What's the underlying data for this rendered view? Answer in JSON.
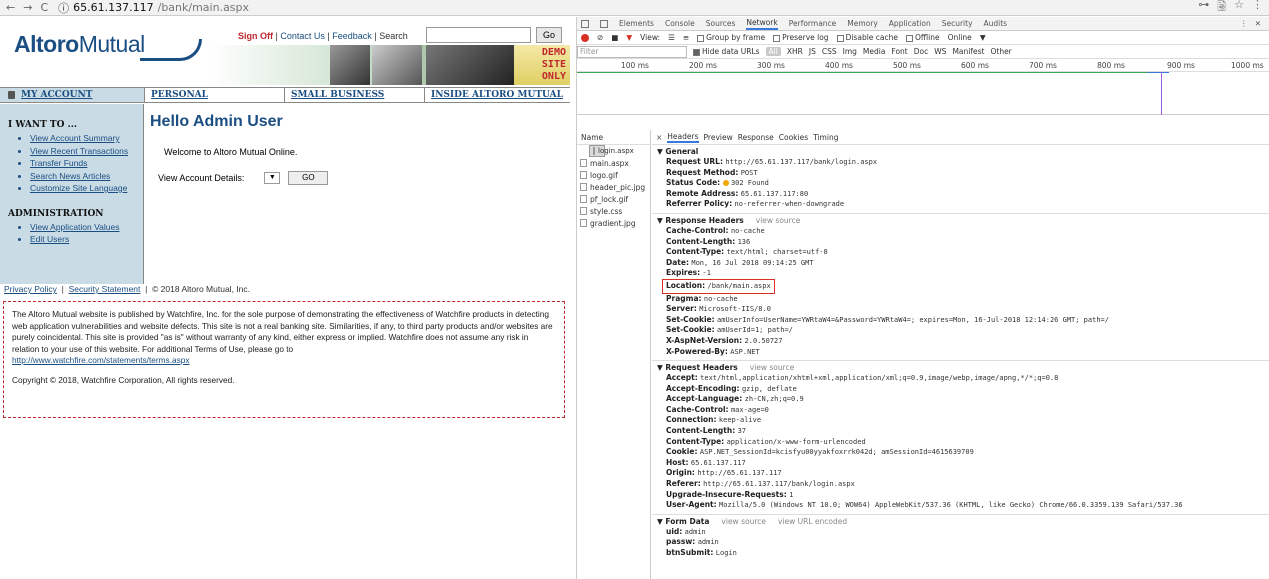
{
  "browser": {
    "host": "65.61.137.117",
    "path": "/bank/main.aspx",
    "back": "←",
    "forward": "→",
    "reload": "C",
    "info": "ⓘ",
    "right_icons": [
      "⊶",
      "🗟",
      "☆",
      "⋮"
    ]
  },
  "site": {
    "logo_bold": "Altoro",
    "logo_light": "Mutual",
    "sign_off": "Sign Off",
    "contact": "Contact Us",
    "feedback": "Feedback",
    "search_label": "Search",
    "go": "Go",
    "demo_lines": [
      "DEMO",
      "SITE",
      "ONLY"
    ],
    "sep": "|",
    "nav": {
      "my_account": "MY ACCOUNT",
      "personal": "PERSONAL",
      "small_business": "SMALL BUSINESS",
      "inside": "INSIDE ALTORO MUTUAL"
    },
    "sidebar": {
      "i_want_to": "I WANT TO ...",
      "items": [
        "View Account Summary",
        "View Recent Transactions",
        "Transfer Funds",
        "Search News Articles",
        "Customize Site Language"
      ],
      "admin_title": "ADMINISTRATION",
      "admin_items": [
        "View Application Values",
        "Edit Users"
      ]
    },
    "main": {
      "title": "Hello Admin User",
      "welcome": "Welcome to Altoro Mutual Online.",
      "details_label": "View Account Details:",
      "select_arrow": "▼",
      "go": "GO"
    },
    "footer": {
      "privacy": "Privacy Policy",
      "security": "Security Statement",
      "copyright": "© 2018 Altoro Mutual, Inc."
    },
    "disclaimer": {
      "text": "The Altoro Mutual website is published by Watchfire, Inc. for the sole purpose of demonstrating the effectiveness of Watchfire products in detecting web application vulnerabilities and website defects. This site is not a real banking site. Similarities, if any, to third party products and/or websites are purely coincidental. This site is provided \"as is\" without warranty of any kind, either express or implied. Watchfire does not assume any risk in relation to your use of this website. For additional Terms of Use, please go to",
      "link": "http://www.watchfire.com/statements/terms.aspx",
      "copy": "Copyright © 2018, Watchfire Corporation, All rights reserved."
    }
  },
  "devtools": {
    "tabs": [
      "Elements",
      "Console",
      "Sources",
      "Network",
      "Performance",
      "Memory",
      "Application",
      "Security",
      "Audits"
    ],
    "active_tab": "Network",
    "tool_items": [
      "View:",
      "Group by frame",
      "Preserve log",
      "Disable cache",
      "Offline",
      "Online",
      "▼"
    ],
    "filter_placeholder": "Filter",
    "filter_types": [
      "Hide data URLs",
      "All",
      "XHR",
      "JS",
      "CSS",
      "Img",
      "Media",
      "Font",
      "Doc",
      "WS",
      "Manifest",
      "Other"
    ],
    "timeline_labels": [
      "100 ms",
      "200 ms",
      "300 ms",
      "400 ms",
      "500 ms",
      "600 ms",
      "700 ms",
      "800 ms",
      "900 ms",
      "1000 ms"
    ],
    "name_header": "Name",
    "files": [
      "login.aspx",
      "main.aspx",
      "logo.gif",
      "header_pic.jpg",
      "pf_lock.gif",
      "style.css",
      "gradient.jpg"
    ],
    "detail_tabs": [
      "×",
      "Headers",
      "Preview",
      "Response",
      "Cookies",
      "Timing"
    ],
    "general_title": "▼ General",
    "general": [
      {
        "k": "Request URL:",
        "v": "http://65.61.137.117/bank/login.aspx"
      },
      {
        "k": "Request Method:",
        "v": "POST"
      },
      {
        "k": "Status Code:",
        "v": "302 Found"
      },
      {
        "k": "Remote Address:",
        "v": "65.61.137.117:80"
      },
      {
        "k": "Referrer Policy:",
        "v": "no-referrer-when-downgrade"
      }
    ],
    "resp_title": "▼ Response Headers",
    "view_source": "view source",
    "view_url_encoded": "view URL encoded",
    "resp": [
      {
        "k": "Cache-Control:",
        "v": "no-cache"
      },
      {
        "k": "Content-Length:",
        "v": "136"
      },
      {
        "k": "Content-Type:",
        "v": "text/html; charset=utf-8"
      },
      {
        "k": "Date:",
        "v": "Mon, 16 Jul 2018 09:14:25 GMT"
      },
      {
        "k": "Expires:",
        "v": "-1"
      }
    ],
    "location": {
      "k": "Location:",
      "v": "/bank/main.aspx"
    },
    "resp2": [
      {
        "k": "Pragma:",
        "v": "no-cache"
      },
      {
        "k": "Server:",
        "v": "Microsoft-IIS/8.0"
      },
      {
        "k": "Set-Cookie:",
        "v": "amUserInfo=UserName=YWRtaW4=&Password=YWRtaW4=; expires=Mon, 16-Jul-2018 12:14:26 GMT; path=/"
      },
      {
        "k": "Set-Cookie:",
        "v": "amUserId=1; path=/"
      },
      {
        "k": "X-AspNet-Version:",
        "v": "2.0.50727"
      },
      {
        "k": "X-Powered-By:",
        "v": "ASP.NET"
      }
    ],
    "req_title": "▼ Request Headers",
    "req": [
      {
        "k": "Accept:",
        "v": "text/html,application/xhtml+xml,application/xml;q=0.9,image/webp,image/apng,*/*;q=0.8"
      },
      {
        "k": "Accept-Encoding:",
        "v": "gzip, deflate"
      },
      {
        "k": "Accept-Language:",
        "v": "zh-CN,zh;q=0.9"
      },
      {
        "k": "Cache-Control:",
        "v": "max-age=0"
      },
      {
        "k": "Connection:",
        "v": "keep-alive"
      },
      {
        "k": "Content-Length:",
        "v": "37"
      },
      {
        "k": "Content-Type:",
        "v": "application/x-www-form-urlencoded"
      },
      {
        "k": "Cookie:",
        "v": "ASP.NET_SessionId=kcisfyu00yyakfoxrrk042d; amSessionId=4615639709"
      },
      {
        "k": "Host:",
        "v": "65.61.137.117"
      },
      {
        "k": "Origin:",
        "v": "http://65.61.137.117"
      },
      {
        "k": "Referer:",
        "v": "http://65.61.137.117/bank/login.aspx"
      },
      {
        "k": "Upgrade-Insecure-Requests:",
        "v": "1"
      },
      {
        "k": "User-Agent:",
        "v": "Mozilla/5.0 (Windows NT 10.0; WOW64) AppleWebKit/537.36 (KHTML, like Gecko) Chrome/66.0.3359.139 Safari/537.36"
      }
    ],
    "form_title": "▼ Form Data",
    "form": [
      {
        "k": "uid:",
        "v": "admin"
      },
      {
        "k": "passw:",
        "v": "admin"
      },
      {
        "k": "btnSubmit:",
        "v": "Login"
      }
    ]
  }
}
